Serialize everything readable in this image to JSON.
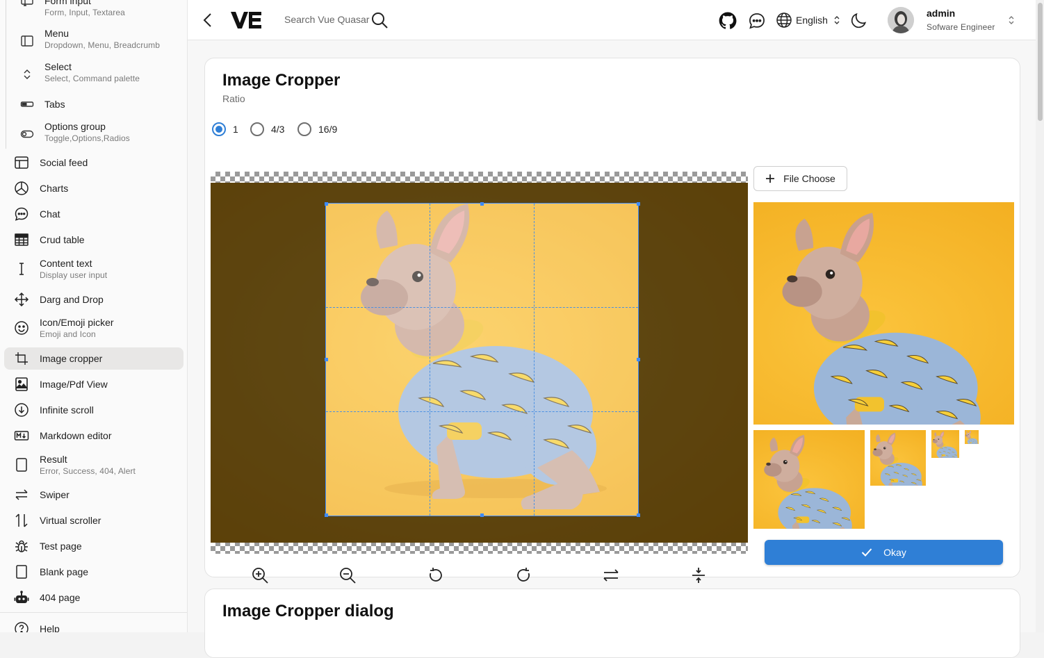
{
  "sidebar": {
    "sub_items": [
      {
        "label": "Form input",
        "caption": "Form, Input, Textarea",
        "icon": "form-input-icon"
      },
      {
        "label": "Menu",
        "caption": "Dropdown, Menu, Breadcrumb",
        "icon": "menu-icon"
      },
      {
        "label": "Select",
        "caption": "Select, Command palette",
        "icon": "select-icon"
      },
      {
        "label": "Tabs",
        "caption": "",
        "icon": "tabs-icon"
      },
      {
        "label": "Options group",
        "caption": "Toggle,Options,Radios",
        "icon": "options-group-icon"
      }
    ],
    "items": [
      {
        "label": "Social feed",
        "caption": "",
        "icon": "social-feed-icon"
      },
      {
        "label": "Charts",
        "caption": "",
        "icon": "charts-icon"
      },
      {
        "label": "Chat",
        "caption": "",
        "icon": "chat-icon"
      },
      {
        "label": "Crud table",
        "caption": "",
        "icon": "table-icon"
      },
      {
        "label": "Content text",
        "caption": "Display user input",
        "icon": "text-cursor-icon"
      },
      {
        "label": "Darg and Drop",
        "caption": "",
        "icon": "move-icon"
      },
      {
        "label": "Icon/Emoji picker",
        "caption": "Emoji and Icon",
        "icon": "emoji-icon"
      },
      {
        "label": "Image cropper",
        "caption": "",
        "icon": "crop-icon",
        "active": true
      },
      {
        "label": "Image/Pdf View",
        "caption": "",
        "icon": "image-icon"
      },
      {
        "label": "Infinite scroll",
        "caption": "",
        "icon": "scroll-down-icon"
      },
      {
        "label": "Markdown editor",
        "caption": "",
        "icon": "markdown-icon"
      },
      {
        "label": "Result",
        "caption": "Error, Success, 404, Alert",
        "icon": "result-icon"
      },
      {
        "label": "Swiper",
        "caption": "",
        "icon": "swiper-icon"
      },
      {
        "label": "Virtual scroller",
        "caption": "",
        "icon": "virtual-scroll-icon"
      },
      {
        "label": "Test page",
        "caption": "",
        "icon": "bug-icon"
      },
      {
        "label": "Blank page",
        "caption": "",
        "icon": "blank-page-icon"
      },
      {
        "label": "404 page",
        "caption": "",
        "icon": "robot-icon"
      }
    ],
    "help_label": "Help"
  },
  "header": {
    "search_placeholder": "Search Vue Quasar",
    "language": "English",
    "user_name": "admin",
    "user_role": "Sofware Engineer"
  },
  "cropper_card": {
    "title": "Image Cropper",
    "subtitle": "Ratio",
    "ratios": [
      "1",
      "4/3",
      "16/9"
    ],
    "selected_ratio": "1",
    "file_button": "File Choose",
    "okay_button": "Okay"
  },
  "dialog_card": {
    "title": "Image Cropper dialog"
  },
  "colors": {
    "accent": "#2f7fd6",
    "active_bg": "#e8e7e6",
    "photo_bg": "#f5b324"
  }
}
